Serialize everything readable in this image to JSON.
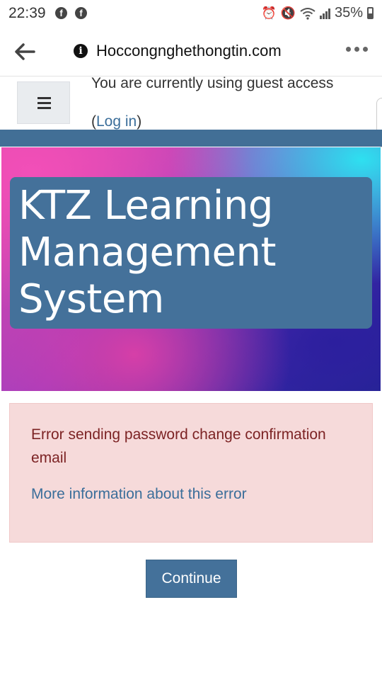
{
  "status_bar": {
    "time": "22:39",
    "notification_icons": [
      "facebook-icon",
      "facebook-icon"
    ],
    "system_icons": [
      "alarm-icon",
      "vibrate-off-icon",
      "wifi-icon",
      "signal-icon",
      "battery-icon"
    ],
    "battery_percent": "35%"
  },
  "browser": {
    "url": "Hoccongnghethongtin.com",
    "icons": {
      "back": "arrow-left-icon",
      "info": "info-icon",
      "menu": "more-horizontal-icon"
    }
  },
  "header": {
    "guest_text": "You are currently using guest access",
    "login_prefix": "(",
    "login_link": "Log in",
    "login_suffix": ")",
    "menu_icon": "hamburger-icon"
  },
  "hero": {
    "title_line1": "KTZ Learning",
    "title_line2": "Management",
    "title_line3": "System"
  },
  "alert": {
    "message": "Error sending password change confirmation email",
    "more_info_link": "More information about this error"
  },
  "actions": {
    "continue_label": "Continue"
  },
  "colors": {
    "brand_blue": "#44719a",
    "link_blue": "#3b6e9a",
    "alert_bg": "#f6dada",
    "alert_text": "#7c2324"
  }
}
